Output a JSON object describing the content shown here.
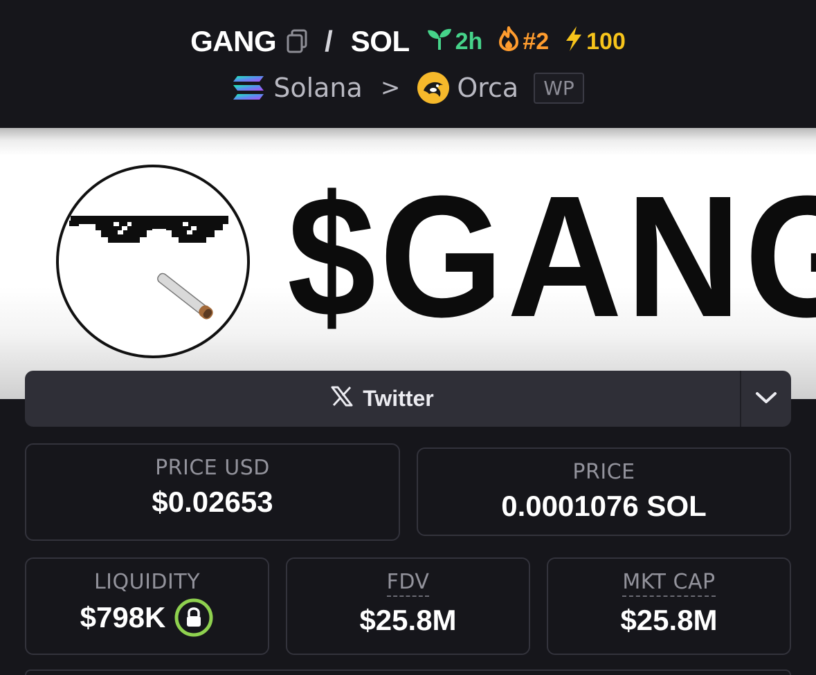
{
  "header": {
    "base_symbol": "GANG",
    "separator": "/",
    "quote_symbol": "SOL",
    "age": "2h",
    "rank": "#2",
    "boosts": "100",
    "chain": "Solana",
    "chain_sep": ">",
    "dex": "Orca",
    "wp_label": "WP"
  },
  "banner": {
    "title": "$GANG"
  },
  "socials": {
    "twitter_label": "Twitter"
  },
  "stats": {
    "price_usd_label": "PRICE USD",
    "price_usd": "$0.02653",
    "price_label": "PRICE",
    "price_native": "0.0001076 SOL",
    "liquidity_label": "LIQUIDITY",
    "liquidity": "$798K",
    "fdv_label": "FDV",
    "fdv": "$25.8M",
    "mkt_cap_label": "MKT CAP",
    "mkt_cap": "$25.8M"
  },
  "colors": {
    "age_green": "#46d38a",
    "rank_orange": "#ff9c2e",
    "boost_yellow": "#f7c41b",
    "lock_green": "#8fd14f"
  },
  "icons": [
    "copy-icon",
    "seedling-icon",
    "flame-icon",
    "lightning-icon",
    "solana-icon",
    "orca-icon",
    "x-logo-icon",
    "chevron-down-icon",
    "lock-icon"
  ]
}
